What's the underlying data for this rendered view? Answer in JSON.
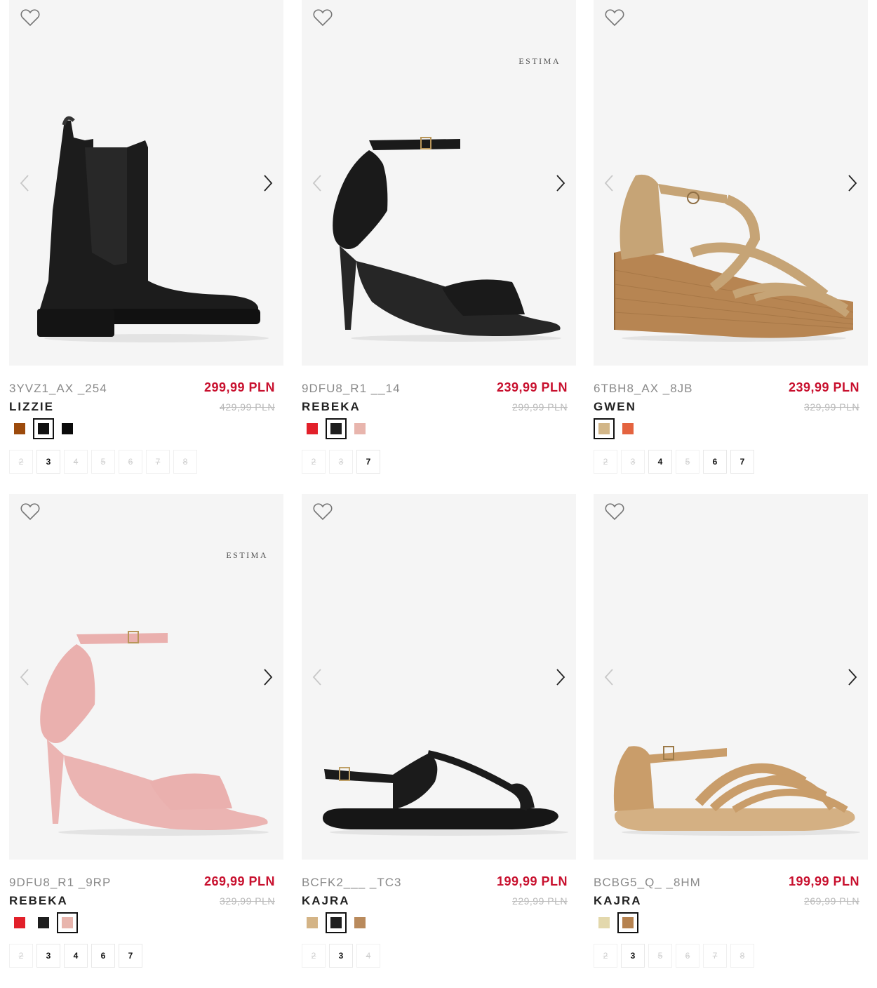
{
  "products": [
    {
      "brand": "",
      "code": "3YVZ1_AX _254",
      "name": "LIZZIE",
      "price": "299,99 PLN",
      "old_price": "429,99 PLN",
      "shoe": "chelsea-boot",
      "shoe_color": "#1c1c1c",
      "swatches": [
        {
          "color": "#9c4a0c",
          "selected": false
        },
        {
          "color": "#111111",
          "selected": true
        },
        {
          "color": "#0b0b0b",
          "selected": false
        }
      ],
      "sizes": [
        {
          "label": "2",
          "available": false
        },
        {
          "label": "3",
          "available": true
        },
        {
          "label": "4",
          "available": false
        },
        {
          "label": "5",
          "available": false
        },
        {
          "label": "6",
          "available": false
        },
        {
          "label": "7",
          "available": false
        },
        {
          "label": "8",
          "available": false
        }
      ]
    },
    {
      "brand": "ESTIMA",
      "code": "9DFU8_R1 __14",
      "name": "REBEKA",
      "price": "239,99 PLN",
      "old_price": "299,99 PLN",
      "shoe": "heel-sandal",
      "shoe_color": "#1a1a1a",
      "swatches": [
        {
          "color": "#e2202a",
          "selected": false
        },
        {
          "color": "#1e1e1e",
          "selected": true
        },
        {
          "color": "#e8b5ad",
          "selected": false
        }
      ],
      "sizes": [
        {
          "label": "2",
          "available": false
        },
        {
          "label": "3",
          "available": false
        },
        {
          "label": "7",
          "available": true
        }
      ]
    },
    {
      "brand": "",
      "code": "6TBH8_AX _8JB",
      "name": "GWEN",
      "price": "239,99 PLN",
      "old_price": "329,99 PLN",
      "shoe": "wedge-sandal",
      "shoe_color": "#c6a476",
      "swatches": [
        {
          "color": "#d2b688",
          "selected": true
        },
        {
          "color": "#e4633f",
          "selected": false
        }
      ],
      "sizes": [
        {
          "label": "2",
          "available": false
        },
        {
          "label": "3",
          "available": false
        },
        {
          "label": "4",
          "available": true
        },
        {
          "label": "5",
          "available": false
        },
        {
          "label": "6",
          "available": true
        },
        {
          "label": "7",
          "available": true
        }
      ]
    },
    {
      "brand": "ESTIMA",
      "code": "9DFU8_R1 _9RP",
      "name": "REBEKA",
      "price": "269,99 PLN",
      "old_price": "329,99 PLN",
      "shoe": "heel-sandal",
      "shoe_color": "#eab0ae",
      "swatches": [
        {
          "color": "#e2202a",
          "selected": false
        },
        {
          "color": "#1e1e1e",
          "selected": false
        },
        {
          "color": "#e8b5ad",
          "selected": true
        }
      ],
      "sizes": [
        {
          "label": "2",
          "available": false
        },
        {
          "label": "3",
          "available": true
        },
        {
          "label": "4",
          "available": true
        },
        {
          "label": "6",
          "available": true
        },
        {
          "label": "7",
          "available": true
        }
      ]
    },
    {
      "brand": "",
      "code": "BCFK2___ _TC3",
      "name": "KAJRA",
      "price": "199,99 PLN",
      "old_price": "229,99 PLN",
      "shoe": "flat-sandal",
      "shoe_color": "#1b1b1b",
      "swatches": [
        {
          "color": "#d4b486",
          "selected": false
        },
        {
          "color": "#1e1e1e",
          "selected": true
        },
        {
          "color": "#b98a5c",
          "selected": false
        }
      ],
      "sizes": [
        {
          "label": "2",
          "available": false
        },
        {
          "label": "3",
          "available": true
        },
        {
          "label": "4",
          "available": false
        }
      ]
    },
    {
      "brand": "",
      "code": "BCBG5_Q_ _8HM",
      "name": "KAJRA",
      "price": "199,99 PLN",
      "old_price": "269,99 PLN",
      "shoe": "strappy-flat",
      "shoe_color": "#c99d6a",
      "swatches": [
        {
          "color": "#e3d8ac",
          "selected": false
        },
        {
          "color": "#b6824f",
          "selected": true
        }
      ],
      "sizes": [
        {
          "label": "2",
          "available": false
        },
        {
          "label": "3",
          "available": true
        },
        {
          "label": "5",
          "available": false
        },
        {
          "label": "6",
          "available": false
        },
        {
          "label": "7",
          "available": false
        },
        {
          "label": "8",
          "available": false
        }
      ]
    }
  ]
}
